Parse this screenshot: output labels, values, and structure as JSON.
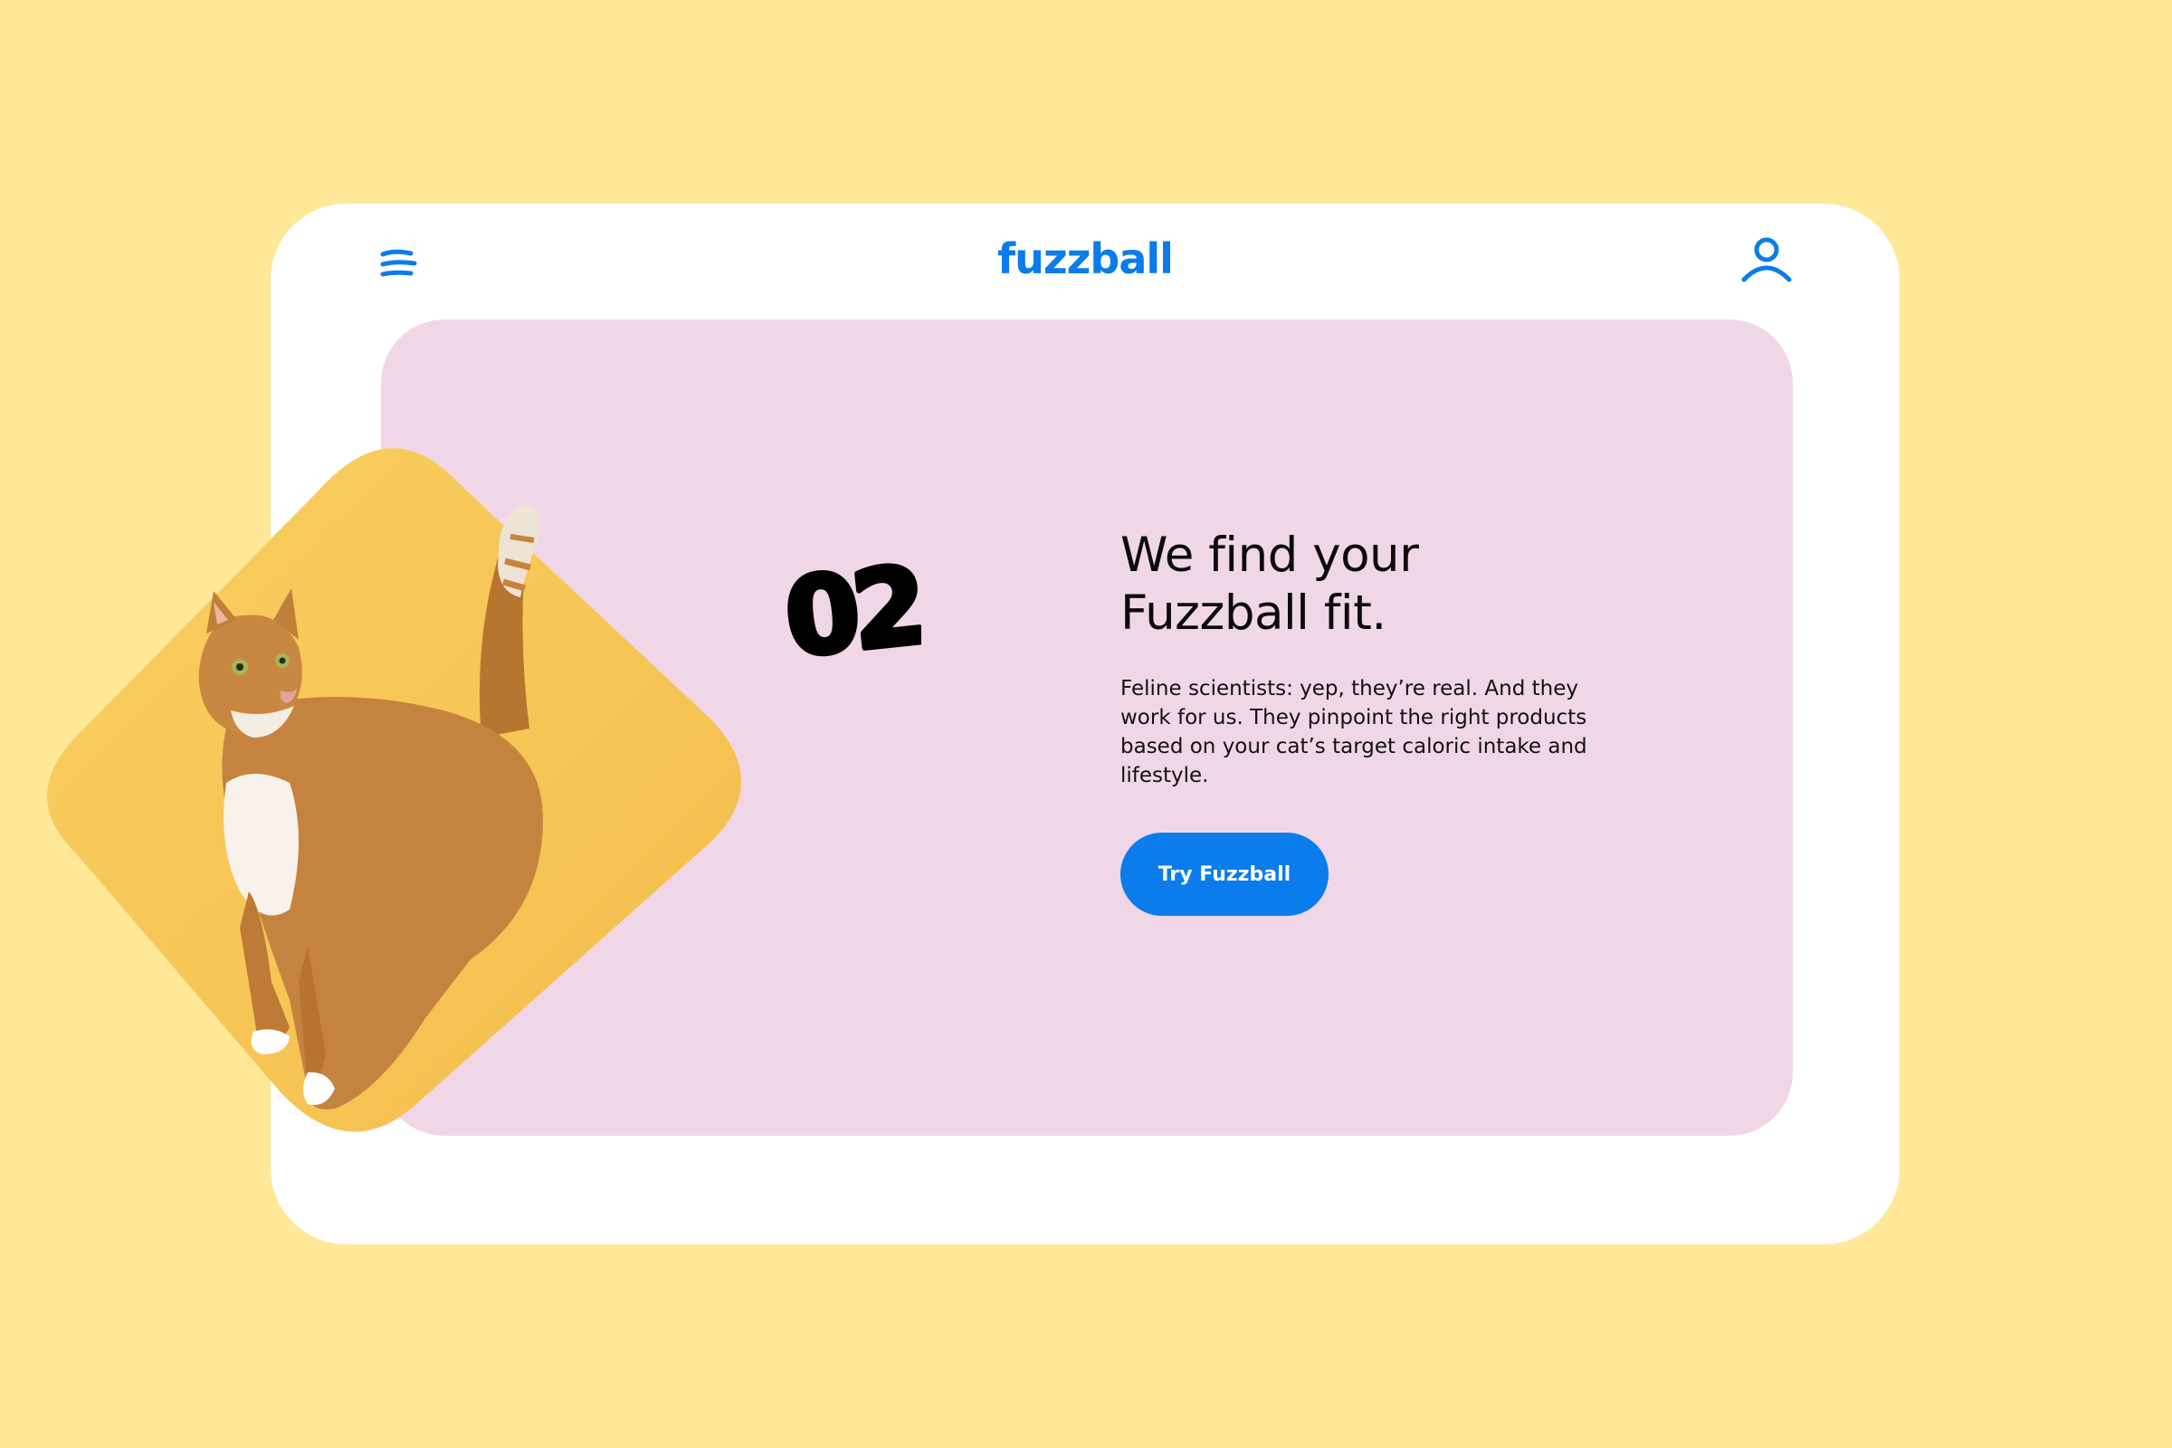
{
  "brand": {
    "name": "fuzzball",
    "color": "#0A7CEB"
  },
  "colors": {
    "background": "#FFE999",
    "device": "#FFFFFF",
    "panel": "#F0D7E8",
    "tile": "#F8C85A",
    "cat_fur": "#C8833E",
    "cta": "#0A7CEB"
  },
  "header": {
    "menu_icon": "menu-icon",
    "account_icon": "user-icon"
  },
  "step": {
    "number": "02",
    "headline_line1": "We find your",
    "headline_line2": "Fuzzball fit.",
    "body": "Feline scientists: yep, they’re real. And they work for us. They pinpoint the right products based on your cat’s target caloric intake and lifestyle.",
    "cta_label": "Try Fuzzball"
  }
}
